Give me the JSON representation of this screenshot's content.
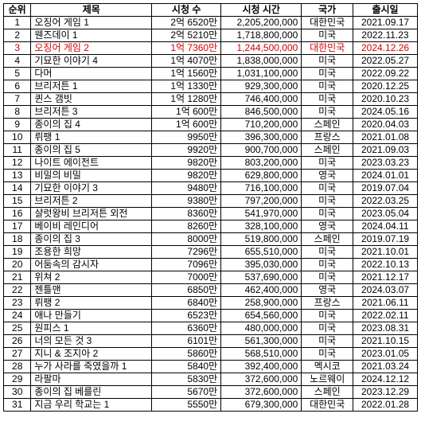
{
  "headers": {
    "rank": "순위",
    "title": "제목",
    "views": "시청 수",
    "hours": "시청 시간",
    "country": "국가",
    "date": "출시일"
  },
  "rows": [
    {
      "rank": "1",
      "title": "오징어 게임 1",
      "views": "2억 6520만",
      "hours": "2,205,200,000",
      "country": "대한민국",
      "date": "2021.09.17",
      "hl": false
    },
    {
      "rank": "2",
      "title": "웬즈데이 1",
      "views": "2억 5210만",
      "hours": "1,718,800,000",
      "country": "미국",
      "date": "2022.11.23",
      "hl": false
    },
    {
      "rank": "3",
      "title": "오징어 게임 2",
      "views": "1억 7360만",
      "hours": "1,244,500,000",
      "country": "대한민국",
      "date": "2024.12.26",
      "hl": true
    },
    {
      "rank": "4",
      "title": "기묘한 이야기 4",
      "views": "1억 4070만",
      "hours": "1,838,000,000",
      "country": "미국",
      "date": "2022.05.27",
      "hl": false
    },
    {
      "rank": "5",
      "title": "다머",
      "views": "1억 1560만",
      "hours": "1,031,100,000",
      "country": "미국",
      "date": "2022.09.22",
      "hl": false
    },
    {
      "rank": "6",
      "title": "브리저튼 1",
      "views": "1억 1330만",
      "hours": "929,300,000",
      "country": "미국",
      "date": "2020.12.25",
      "hl": false
    },
    {
      "rank": "7",
      "title": "퀸스 갬빗",
      "views": "1억 1280만",
      "hours": "746,400,000",
      "country": "미국",
      "date": "2020.10.23",
      "hl": false
    },
    {
      "rank": "8",
      "title": "브리저튼 3",
      "views": "1억  600만",
      "hours": "846,500,000",
      "country": "미국",
      "date": "2024.05.16",
      "hl": false
    },
    {
      "rank": "9",
      "title": "종이의 집 4",
      "views": "1억  600만",
      "hours": "710,200,000",
      "country": "스페인",
      "date": "2020.04.03",
      "hl": false
    },
    {
      "rank": "10",
      "title": "뤼팽 1",
      "views": "9950만",
      "hours": "396,300,000",
      "country": "프랑스",
      "date": "2021.01.08",
      "hl": false
    },
    {
      "rank": "11",
      "title": "종이의 집 5",
      "views": "9920만",
      "hours": "900,700,000",
      "country": "스페인",
      "date": "2021.09.03",
      "hl": false
    },
    {
      "rank": "12",
      "title": "나이트 에이전트",
      "views": "9820만",
      "hours": "803,200,000",
      "country": "미국",
      "date": "2023.03.23",
      "hl": false
    },
    {
      "rank": "13",
      "title": "비밀의 비밀",
      "views": "9820만",
      "hours": "629,800,000",
      "country": "영국",
      "date": "2024.01.01",
      "hl": false
    },
    {
      "rank": "14",
      "title": "기묘한 이야기 3",
      "views": "9480만",
      "hours": "716,100,000",
      "country": "미국",
      "date": "2019.07.04",
      "hl": false
    },
    {
      "rank": "15",
      "title": "브리저튼 2",
      "views": "9380만",
      "hours": "797,200,000",
      "country": "미국",
      "date": "2022.03.25",
      "hl": false
    },
    {
      "rank": "16",
      "title": "샬럿왕비 브리저튼 외전",
      "views": "8360만",
      "hours": "541,970,000",
      "country": "미국",
      "date": "2023.05.04",
      "hl": false
    },
    {
      "rank": "17",
      "title": "베이비 레인디어",
      "views": "8260만",
      "hours": "328,100,000",
      "country": "영국",
      "date": "2024.04.11",
      "hl": false
    },
    {
      "rank": "18",
      "title": "종이의 집 3",
      "views": "8000만",
      "hours": "519,800,000",
      "country": "스페인",
      "date": "2019.07.19",
      "hl": false
    },
    {
      "rank": "19",
      "title": "조용한 희망",
      "views": "7296만",
      "hours": "655,510,000",
      "country": "미국",
      "date": "2021.10.01",
      "hl": false
    },
    {
      "rank": "20",
      "title": "어둠속의 감시자",
      "views": "7096만",
      "hours": "395,030,000",
      "country": "미국",
      "date": "2022.10.13",
      "hl": false
    },
    {
      "rank": "21",
      "title": "위쳐 2",
      "views": "7000만",
      "hours": "537,690,000",
      "country": "미국",
      "date": "2021.12.17",
      "hl": false
    },
    {
      "rank": "22",
      "title": "젠틀맨",
      "views": "6850만",
      "hours": "462,400,000",
      "country": "영국",
      "date": "2024.03.07",
      "hl": false
    },
    {
      "rank": "23",
      "title": "뤼팽 2",
      "views": "6840만",
      "hours": "258,900,000",
      "country": "프랑스",
      "date": "2021.06.11",
      "hl": false
    },
    {
      "rank": "24",
      "title": "애나 만들기",
      "views": "6523만",
      "hours": "654,560,000",
      "country": "미국",
      "date": "2022.02.11",
      "hl": false
    },
    {
      "rank": "25",
      "title": "원피스 1",
      "views": "6360만",
      "hours": "480,000,000",
      "country": "미국",
      "date": "2023.08.31",
      "hl": false
    },
    {
      "rank": "26",
      "title": "너의 모든 것 3",
      "views": "6101만",
      "hours": "561,300,000",
      "country": "미국",
      "date": "2021.10.15",
      "hl": false
    },
    {
      "rank": "27",
      "title": "지니 & 조지아 2",
      "views": "5860만",
      "hours": "568,510,000",
      "country": "미국",
      "date": "2023.01.05",
      "hl": false
    },
    {
      "rank": "28",
      "title": "누가 사라를 죽였을까 1",
      "views": "5840만",
      "hours": "392,400,000",
      "country": "멕시코",
      "date": "2021.03.24",
      "hl": false
    },
    {
      "rank": "29",
      "title": "라팔마",
      "views": "5830만",
      "hours": "372,600,000",
      "country": "노르웨이",
      "date": "2024.12.12",
      "hl": false
    },
    {
      "rank": "30",
      "title": "종이의 집 베를린",
      "views": "5670만",
      "hours": "372,600,000",
      "country": "스페인",
      "date": "2023.12.29",
      "hl": false
    },
    {
      "rank": "31",
      "title": "지금 우리 학교는 1",
      "views": "5550만",
      "hours": "679,300,000",
      "country": "대한민국",
      "date": "2022.01.28",
      "hl": false
    }
  ]
}
